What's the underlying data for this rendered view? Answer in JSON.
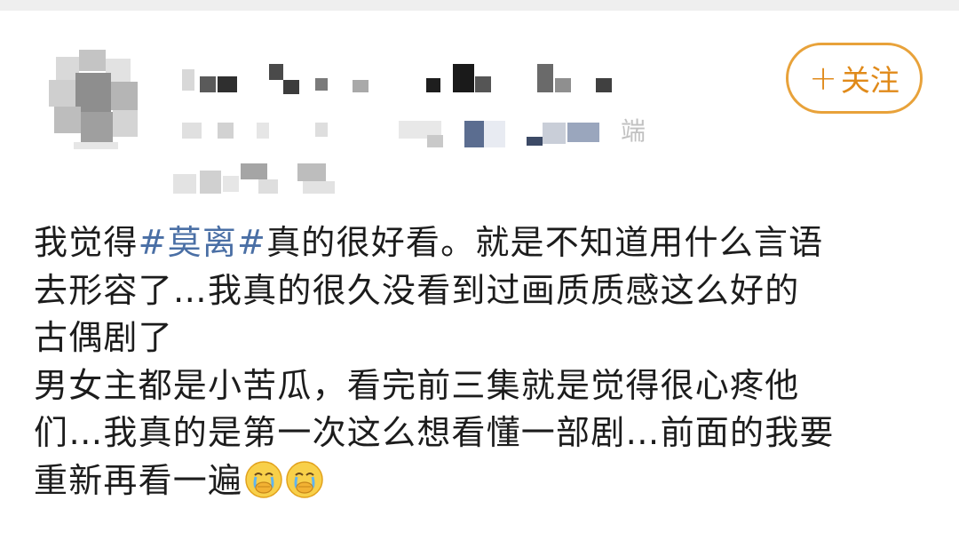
{
  "post": {
    "follow_button": {
      "icon": "plus-icon",
      "plus": "+",
      "label": "关注"
    },
    "source_suffix": "端",
    "body": {
      "line1_pre": "我觉得",
      "hashtag": "#莫离#",
      "line1_post": "真的很好看。就是不知道用什么言语",
      "line2": "去形容了…我真的很久没看到过画质质感这么好的",
      "line3": "古偶剧了",
      "line4": "男女主都是小苦瓜，看完前三集就是觉得很心疼他",
      "line5": "们…我真的是第一次这么想看懂一部剧…前面的我要",
      "line6": "重新再看一遍"
    },
    "emojis": [
      "crying-face-emoji",
      "crying-face-emoji"
    ]
  },
  "colors": {
    "accent": "#e8a23a",
    "hashtag": "#4a6fa5",
    "text": "#1c1c1c"
  }
}
